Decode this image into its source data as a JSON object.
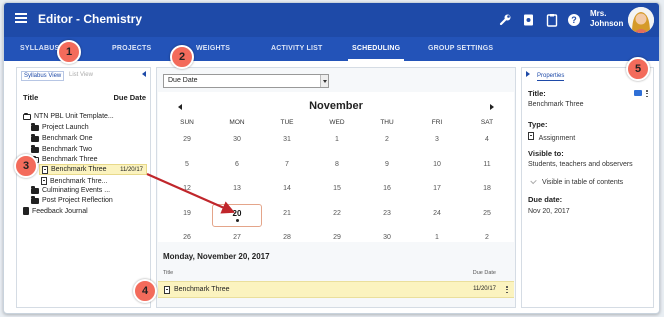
{
  "header": {
    "title": "Editor - Chemistry",
    "user_name": "Mrs. Johnson",
    "tools": [
      "wrench-icon",
      "view-icon",
      "clipboard-icon",
      "help-icon"
    ],
    "bg_color": "#1e4aa8"
  },
  "tabs": [
    {
      "label": "SYLLABUS",
      "active": false
    },
    {
      "label": "PROJECTS",
      "active": false
    },
    {
      "label": "WEIGHTS",
      "active": false
    },
    {
      "label": "ACTIVITY LIST",
      "active": false
    },
    {
      "label": "SCHEDULING",
      "active": true
    },
    {
      "label": "GROUP SETTINGS",
      "active": false
    }
  ],
  "left_panel": {
    "view_tabs": [
      "Syllabus View",
      "List View"
    ],
    "col_title": "Title",
    "col_due": "Due Date",
    "tree": [
      {
        "label": "NTN PBL Unit Template...",
        "icon": "folder-open-icon"
      },
      {
        "label": "Project Launch",
        "icon": "folder-icon"
      },
      {
        "label": "Benchmark One",
        "icon": "folder-icon"
      },
      {
        "label": "Benchmark Two",
        "icon": "folder-icon"
      },
      {
        "label": "Benchmark Three",
        "icon": "folder-open-icon"
      },
      {
        "label": "Benchmark Three",
        "icon": "document-icon",
        "date": "11/20/17"
      },
      {
        "label": "Benchmark Thre...",
        "icon": "document-icon"
      },
      {
        "label": "Culminating Events ...",
        "icon": "folder-icon"
      },
      {
        "label": "Post Project Reflection",
        "icon": "folder-icon"
      },
      {
        "label": "Feedback Journal",
        "icon": "journal-icon"
      }
    ]
  },
  "calendar": {
    "filter_value": "Due Date",
    "month": "November",
    "weekdays": [
      "SUN",
      "MON",
      "TUE",
      "WED",
      "THU",
      "FRI",
      "SAT"
    ],
    "weeks": [
      [
        "29",
        "30",
        "31",
        "1",
        "2",
        "3",
        "4"
      ],
      [
        "5",
        "6",
        "7",
        "8",
        "9",
        "10",
        "11"
      ],
      [
        "12",
        "13",
        "14",
        "15",
        "16",
        "17",
        "18"
      ],
      [
        "19",
        "20",
        "21",
        "22",
        "23",
        "24",
        "25"
      ],
      [
        "26",
        "27",
        "28",
        "29",
        "30",
        "1",
        "2"
      ]
    ],
    "today": "20",
    "selected_date": "Monday, November 20, 2017",
    "list_col_title": "Title",
    "list_col_due": "Due Date",
    "items": [
      {
        "title": "Benchmark Three",
        "date": "11/20/17"
      }
    ]
  },
  "properties": {
    "tab": "Properties",
    "title_label": "Title:",
    "title_value": "Benchmark Three",
    "type_label": "Type:",
    "type_value": "Assignment",
    "visible_label": "Visible to:",
    "visible_value": "Students, teachers and observers",
    "toc_label": "Visible in table of contents",
    "due_label": "Due date:",
    "due_value": "Nov 20, 2017"
  },
  "annotations": [
    "1",
    "2",
    "3",
    "4",
    "5"
  ],
  "annotation_color": "#f36b5b"
}
